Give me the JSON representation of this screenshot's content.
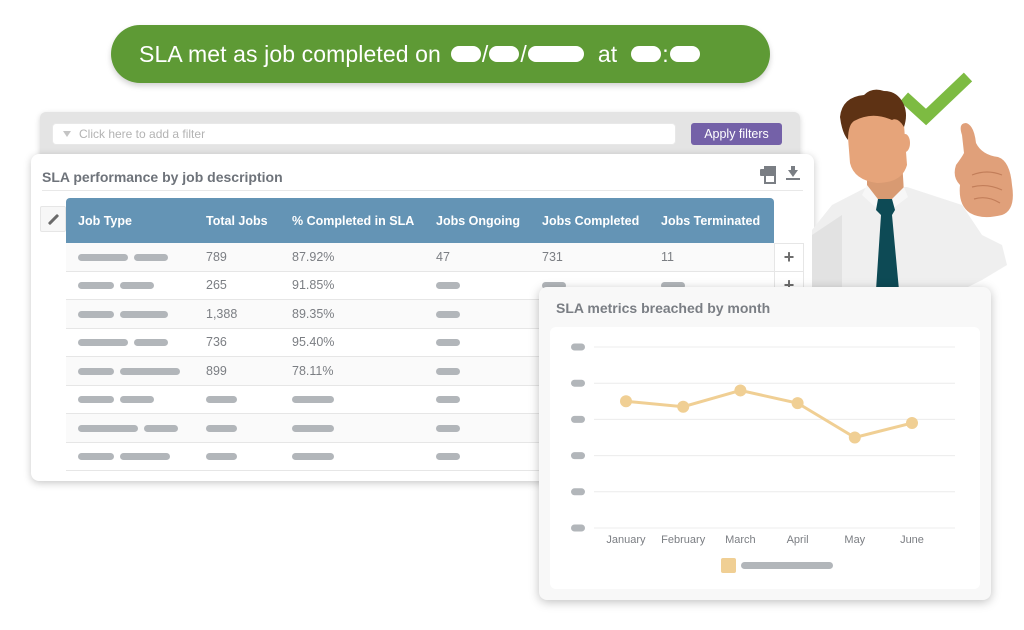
{
  "banner": {
    "text": "SLA met as job completed on",
    "date_separator": "/",
    "at_label": "at",
    "time_separator": ":",
    "date_redacted": true,
    "time_redacted": true,
    "color": "#5e9a35"
  },
  "filter_bar": {
    "placeholder": "Click here to add a filter",
    "icon": "filter-funnel-icon",
    "apply_label": "Apply filters",
    "apply_color": "#7461a8"
  },
  "table_card": {
    "title": "SLA performance by job description",
    "actions": [
      "print-icon",
      "download-icon"
    ],
    "edit_icon": "pencil-icon",
    "header_color": "#6494b5",
    "columns": [
      "Job Type",
      "Total Jobs",
      "% Completed in SLA",
      "Jobs Ongoing",
      "Jobs Completed",
      "Jobs Terminated"
    ],
    "rows": [
      {
        "job_type": null,
        "total_jobs": "789",
        "pct_sla": "87.92%",
        "ongoing": "47",
        "completed": "731",
        "terminated": "11"
      },
      {
        "job_type": null,
        "total_jobs": "265",
        "pct_sla": "91.85%",
        "ongoing": null,
        "completed": null,
        "terminated": null
      },
      {
        "job_type": null,
        "total_jobs": "1,388",
        "pct_sla": "89.35%",
        "ongoing": null,
        "completed": null,
        "terminated": null
      },
      {
        "job_type": null,
        "total_jobs": "736",
        "pct_sla": "95.40%",
        "ongoing": null,
        "completed": null,
        "terminated": null
      },
      {
        "job_type": null,
        "total_jobs": "899",
        "pct_sla": "78.11%",
        "ongoing": null,
        "completed": null,
        "terminated": null
      },
      {
        "job_type": null,
        "total_jobs": null,
        "pct_sla": null,
        "ongoing": null,
        "completed": null,
        "terminated": null
      },
      {
        "job_type": null,
        "total_jobs": null,
        "pct_sla": null,
        "ongoing": null,
        "completed": null,
        "terminated": null
      },
      {
        "job_type": null,
        "total_jobs": null,
        "pct_sla": null,
        "ongoing": null,
        "completed": null,
        "terminated": null
      }
    ],
    "expand_label": "+"
  },
  "chart_card": {
    "title": "SLA metrics breached by month"
  },
  "chart_data": {
    "type": "line",
    "title": "SLA metrics breached by month",
    "categories": [
      "January",
      "February",
      "March",
      "April",
      "May",
      "June"
    ],
    "series": [
      {
        "name": "(redacted)",
        "values": [
          3.5,
          3.35,
          3.8,
          3.45,
          2.5,
          2.9
        ],
        "color": "#f0cf94"
      }
    ],
    "y_ticks_redacted": true,
    "y_tick_count": 6,
    "ylim": [
      0,
      5
    ],
    "grid": true,
    "legend": "bottom-center",
    "xlabel": "",
    "ylabel": ""
  },
  "illustration": {
    "subject": "businessman giving thumbs up",
    "check_color": "#7dbb42",
    "tie_color": "#0d4a55"
  }
}
